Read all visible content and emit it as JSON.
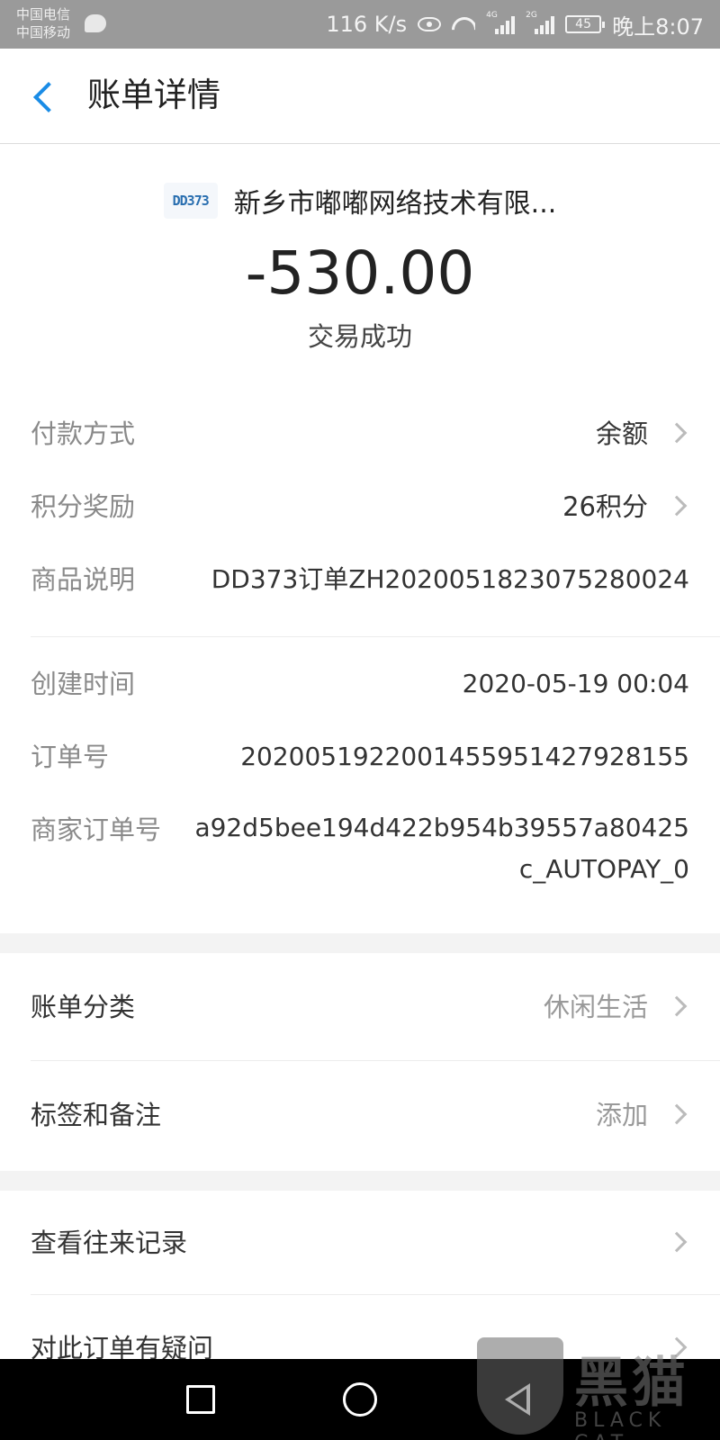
{
  "status_bar": {
    "carrier_1": "中国电信",
    "carrier_2": "中国移动",
    "speed": "116 K/s",
    "signal_1": "4G",
    "signal_2": "2G",
    "battery": "45",
    "time": "晚上8:07"
  },
  "header": {
    "title": "账单详情"
  },
  "merchant": {
    "logo_text": "DD373",
    "name": "新乡市嘟嘟网络技术有限...",
    "amount": "-530.00",
    "status": "交易成功"
  },
  "details": [
    {
      "label": "付款方式",
      "value": "余额"
    },
    {
      "label": "积分奖励",
      "value": "26积分"
    },
    {
      "label": "商品说明",
      "value": "DD373订单ZH20200518230752800​24"
    },
    {
      "label": "创建时间",
      "value": "2020-05-19 00:04"
    },
    {
      "label": "订单号",
      "value": "2020051922001455951427928155"
    },
    {
      "label": "商家订单号",
      "value": "a92d5bee194d422b954b39557a80425c_AUTOPAY_0"
    }
  ],
  "category": {
    "label": "账单分类",
    "value": "休闲生活"
  },
  "tags": {
    "label": "标签和备注",
    "value": "添加"
  },
  "history": {
    "label": "查看往来记录"
  },
  "question": {
    "label": "对此订单有疑问"
  },
  "watermark": {
    "text": "黑猫",
    "sub": "BLACK CAT"
  }
}
